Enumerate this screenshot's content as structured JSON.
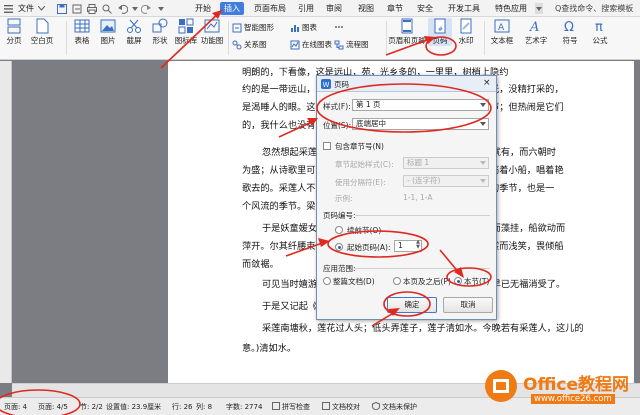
{
  "menubar": {
    "file": "文件",
    "tabs": [
      "开始",
      "插入",
      "页面布局",
      "引用",
      "审阅",
      "视图",
      "章节",
      "安全",
      "开发工具",
      "特色应用"
    ],
    "active_tab": "插入",
    "search": "Q查找命令、搜索模板"
  },
  "ribbon": {
    "groups": [
      {
        "label": "分页"
      },
      {
        "label": "空白页"
      },
      {
        "label": "表格"
      },
      {
        "label": "图片"
      },
      {
        "label": "截屏"
      },
      {
        "label": "形状"
      },
      {
        "label": "图标库"
      },
      {
        "label": "功能图"
      }
    ],
    "small": [
      "智能图形",
      "图表",
      "在线图表",
      "关系图",
      "流程图"
    ],
    "right": [
      {
        "label": "页眉和页脚"
      },
      {
        "label": "页码"
      },
      {
        "label": "水印"
      },
      {
        "label": "文本框"
      },
      {
        "label": "艺术字"
      },
      {
        "label": "符号"
      },
      {
        "label": "公式"
      }
    ]
  },
  "doc": {
    "lines": [
      "明朗的，下看像，这是远山，苑，光乡多的，一里里，树梢上隐约",
      "约的是一带远山，只有些大意罢了。树缝里也漏着一两点路灯光，没精打采的，",
      "是渴睡人的眼。这时候最热闹的，要数树上的蝉声与水里的蛙声；但热闹是它们",
      "的，我什么也没有。",
      "忽然想起采莲的事情来了。采莲是江南的旧俗，似乎很早就有，而六朝时",
      "为盛；从诗歌里可以约略知道。采莲的是少年的女子，她们是荡着小船，唱着艳",
      "歌去的。采莲人不用说很多，还有看采莲的人。那是一个热闹的季节，也是一",
      "个风流的季节。梁元帝《采莲赋》里说得好：",
      "于是妖童媛女，荡舟心许；鹢首徐回，兼传羽杯；棹将移而藻挂，船欲动而",
      "萍开。尔其纤腰束素，迁延顾步；夏始春余，叶嫩花初，恐沾裳而浅笑，畏倾船",
      "而敛裾。",
      "可见当时嬉游的光景了。这真是有趣的事，可惜我们现在早已无福消受了。",
      "于是又记起《西洲曲》里的句子：",
      "采莲南塘秋，莲花过人头；低头弄莲子，莲子清如水。今晚若有采莲人，这儿的",
      "意。)清如水。"
    ]
  },
  "dialog": {
    "title": "页码",
    "style_label": "样式(F):",
    "style_value": "第 1 页",
    "position_label": "位置(S):",
    "position_value": "底端居中",
    "include_chapter": "包含章节号(N)",
    "chapter_style_label": "章节起始样式(C):",
    "chapter_style_value": "标题 1",
    "separator_label": "使用分隔符(E):",
    "separator_value": "- (连字符)",
    "example_label": "示例:",
    "example_value": "1-1, 1-A",
    "numbering_group": "页码编号:",
    "continue_label": "续前节(O)",
    "start_label": "起始页码(A):",
    "start_value": "1",
    "apply_group": "应用范围:",
    "apply_options": [
      "整篇文档(D)",
      "本页及之后(P)",
      "本节(T)"
    ],
    "ok": "确定",
    "cancel": "取消"
  },
  "status": {
    "items": [
      "页面: 4",
      "页面: 4/5",
      "节: 2/2",
      "设置值: 23.9厘米",
      "行: 26",
      "列: 8",
      "字数: 2774",
      "拼写检查",
      "文档校对",
      "文档未保护"
    ]
  },
  "watermark": {
    "brand": "Office教程网",
    "url": "www.office26.com"
  },
  "colors": {
    "accent": "#3f7ede",
    "annotation": "#e0281f",
    "logo": "#f07a13"
  }
}
